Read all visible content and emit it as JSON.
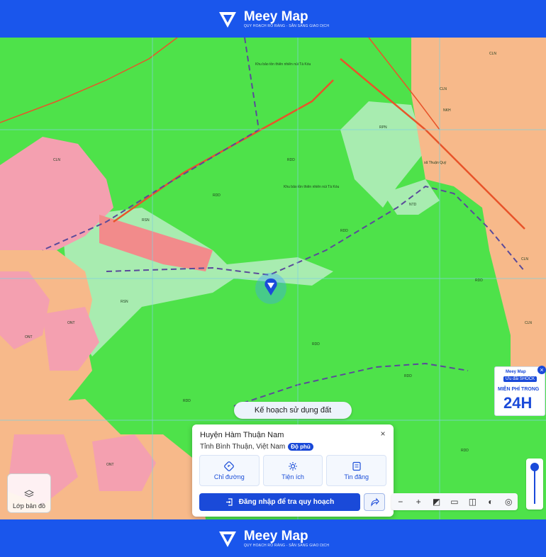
{
  "brand": {
    "name": "Meey Map",
    "slogan": "QUY HOẠCH RÕ RÀNG - SẴN SÀNG GIAO DỊCH"
  },
  "map": {
    "labels": {
      "rdd": "RDD",
      "cln": "CLN",
      "ont": "ONT",
      "nkh": "NKH",
      "rsn": "RSN",
      "rpn": "RPN",
      "ntd": "NTD",
      "reserve": "Khu bảo tồn thiên nhiên núi Tà Kóu",
      "thuanquy": "xã Thuận Quý"
    }
  },
  "plan_pill": "Kế hoạch sử dụng đất",
  "info_card": {
    "title": "Huyện Hàm Thuận Nam",
    "subtitle": "Tỉnh Bình Thuận, Việt Nam",
    "badge": "Độ phủ",
    "actions": [
      {
        "label": "Chỉ đường"
      },
      {
        "label": "Tiện ích"
      },
      {
        "label": "Tin đăng"
      }
    ],
    "login_label": "Đăng nhập để tra quy hoạch",
    "close_glyph": "×"
  },
  "toolbar": {
    "minus": "−",
    "plus": "+"
  },
  "layer_button": "Lớp bản đồ",
  "ad": {
    "brand": "Meey Map",
    "tag": "Ưu đãi SHOCK",
    "line": "MIỄN PHÍ TRONG",
    "big": "24H",
    "close": "×"
  },
  "colors": {
    "brand_blue": "#1a56ec",
    "forest_green": "#4ee24a",
    "residential_pink": "#f4a0b0",
    "agri_orange": "#f7b98a"
  }
}
